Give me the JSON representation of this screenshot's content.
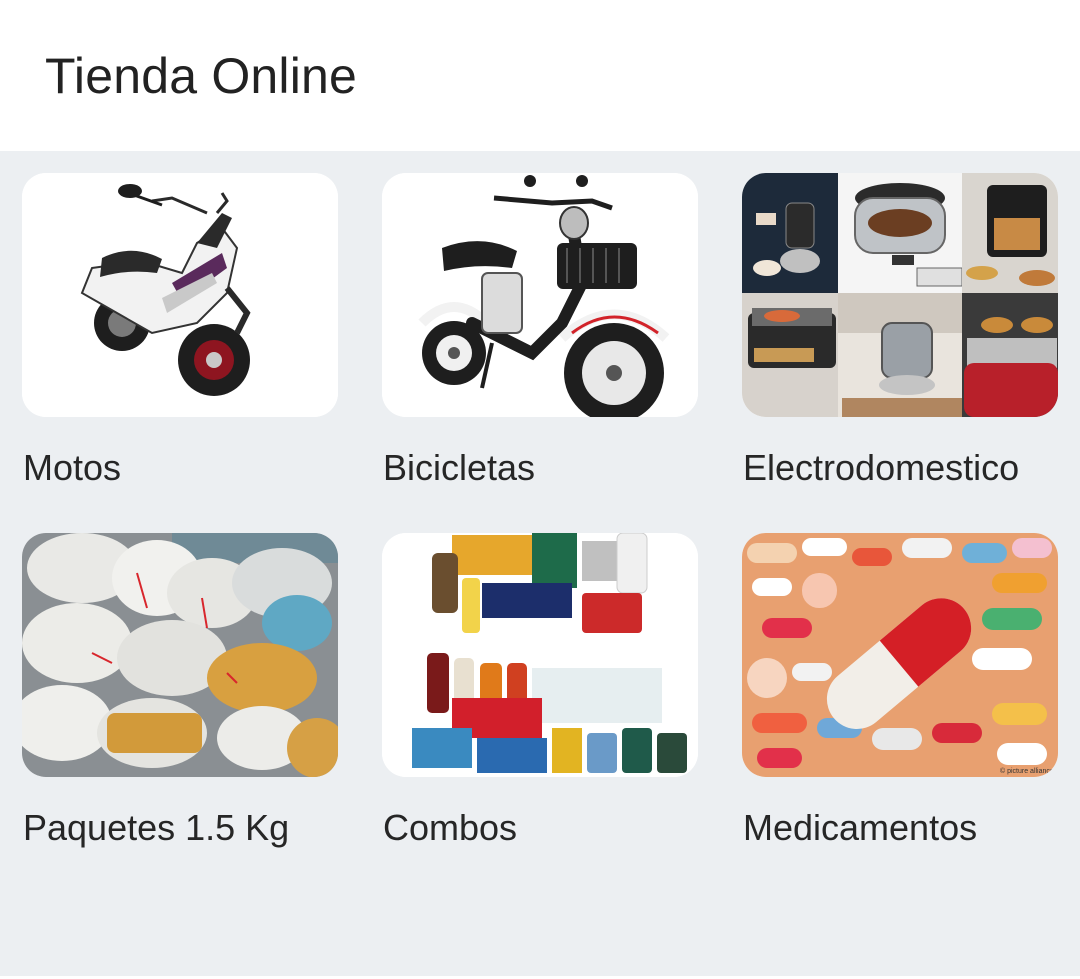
{
  "app_bar": {
    "title": "Tienda Online"
  },
  "colors": {
    "background": "#eceff2",
    "app_bar": "#ffffff",
    "text": "#222222"
  },
  "categories": [
    {
      "label": "Motos",
      "image": "scooter-image"
    },
    {
      "label": "Bicicletas",
      "image": "electric-bicycle-image"
    },
    {
      "label": "Electrodomestico",
      "image": "kitchen-appliances-collage-image"
    },
    {
      "label": "Paquetes 1.5 Kg",
      "image": "sacks-of-packages-image"
    },
    {
      "label": "Combos",
      "image": "grocery-products-image"
    },
    {
      "label": "Medicamentos",
      "image": "pills-capsules-image"
    }
  ]
}
